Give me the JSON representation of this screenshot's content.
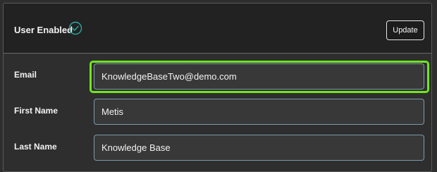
{
  "header": {
    "user_enabled_label": "User Enabled",
    "status_icon": "check-circle-icon",
    "update_label": "Update"
  },
  "fields": {
    "email": {
      "label": "Email",
      "value": "KnowledgeBaseTwo@demo.com"
    },
    "first_name": {
      "label": "First Name",
      "value": "Metis"
    },
    "last_name": {
      "label": "Last Name",
      "value": "Knowledge Base"
    }
  },
  "colors": {
    "highlight": "#6fe61e",
    "check": "#2aa8a0",
    "input_border": "#7d99a8"
  }
}
